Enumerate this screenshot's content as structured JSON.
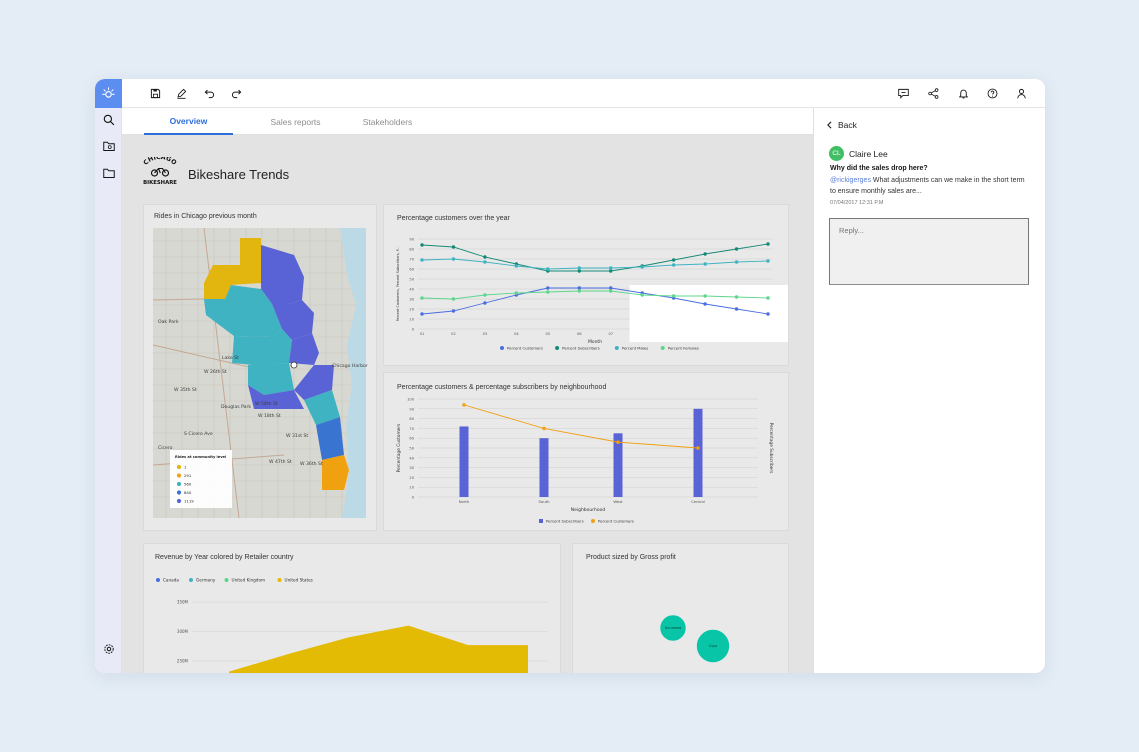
{
  "toolbar": {
    "left_icons": [
      "save-icon",
      "edit-icon",
      "undo-icon",
      "redo-icon"
    ],
    "right_icons": [
      "comment-icon",
      "share-icon",
      "notification-icon",
      "help-icon",
      "user-icon"
    ]
  },
  "rail": {
    "icons": [
      "search-icon",
      "folder-search-icon",
      "folder-icon",
      "settings-icon"
    ]
  },
  "tabs": [
    {
      "label": "Overview",
      "active": true
    },
    {
      "label": "Sales reports",
      "active": false
    },
    {
      "label": "Stakeholders",
      "active": false
    }
  ],
  "dashboard": {
    "logo_text_top": "CHICAGO",
    "logo_text_bottom": "BIKESHARE",
    "title": "Bikeshare Trends"
  },
  "map_card": {
    "title": "Rides in Chicago previous month",
    "legend_title": "Rides at community level",
    "legend_items": [
      {
        "label": "1",
        "color": "#e3b50f"
      },
      {
        "label": "291",
        "color": "#f0a10f"
      },
      {
        "label": "560",
        "color": "#3fb3c1"
      },
      {
        "label": "840",
        "color": "#3a74d1"
      },
      {
        "label": "1119",
        "color": "#5a63d6"
      }
    ],
    "place_labels": [
      "Chicago Harbor",
      "Cicero",
      "Oak Park",
      "W 18th St",
      "W 31st St",
      "W 26th St",
      "W 35th St",
      "Lake St",
      "Douglas Park",
      "W 58th St",
      "W 36th St",
      "W 47th St",
      "S Cicero Ave"
    ]
  },
  "chart_data": [
    {
      "type": "line",
      "title": "Percentage customers over the year",
      "xlabel": "Month",
      "ylabel": "Percent Customers, Percent Subscribers, P...",
      "categories": [
        "01",
        "02",
        "03",
        "04",
        "05",
        "06",
        "07",
        "08",
        "09",
        "10",
        "11",
        "12"
      ],
      "ylim": [
        0,
        90
      ],
      "yticks": [
        0,
        10,
        20,
        30,
        40,
        50,
        60,
        70,
        80,
        90
      ],
      "series": [
        {
          "name": "Percent Customers",
          "color": "#4a6ee0",
          "values": [
            15,
            18,
            26,
            34,
            41,
            41,
            41,
            36,
            31,
            25,
            20,
            15
          ]
        },
        {
          "name": "Percent Subscribers",
          "color": "#138a75",
          "values": [
            84,
            82,
            72,
            65,
            58,
            58,
            58,
            63,
            69,
            75,
            80,
            85
          ]
        },
        {
          "name": "Percent Males",
          "color": "#3fb3c1",
          "values": [
            69,
            70,
            67,
            63,
            60,
            61,
            61,
            62,
            64,
            65,
            67,
            68
          ]
        },
        {
          "name": "Percent Females",
          "color": "#5cd68a",
          "values": [
            31,
            30,
            34,
            36,
            37,
            38,
            38,
            34,
            33,
            33,
            32,
            31
          ]
        }
      ],
      "grid": true,
      "legend": "bottom"
    },
    {
      "type": "bar",
      "title": "Percentage customers & percentage subscribers by neighbourhood",
      "xlabel": "Neighbourhood",
      "ylabel": "Percentage Customers",
      "y2label": "Percentage Subscribers",
      "categories": [
        "North",
        "South",
        "West",
        "Central"
      ],
      "ylim": [
        0,
        100
      ],
      "yticks": [
        0,
        10,
        20,
        30,
        40,
        50,
        60,
        70,
        80,
        90,
        100
      ],
      "series": [
        {
          "name": "Percent Subscribers",
          "type": "bar",
          "color": "#5a63d6",
          "values": [
            72,
            60,
            65,
            90
          ]
        },
        {
          "name": "Percent Customers",
          "type": "line",
          "color": "#f0a010",
          "values": [
            94,
            70,
            56,
            50
          ]
        }
      ],
      "grid": true,
      "legend": "bottom"
    },
    {
      "type": "area",
      "title": "Revenue by Year colored by Retailer country",
      "yticks": [
        "350M",
        "300M",
        "250M"
      ],
      "ylim": [
        230,
        360
      ],
      "x": [
        0,
        1,
        2,
        3,
        4,
        5
      ],
      "series": [
        {
          "name": "Canada",
          "color": "#4a6ee0",
          "values": [
            230,
            232,
            234,
            236,
            238,
            240
          ]
        },
        {
          "name": "Germany",
          "color": "#3fb3c1",
          "values": [
            231,
            233,
            235,
            237,
            239,
            241
          ]
        },
        {
          "name": "United Kingdom",
          "color": "#5cd68a",
          "values": [
            232,
            234,
            236,
            238,
            240,
            242
          ]
        },
        {
          "name": "United States",
          "color": "#e3bb05",
          "values": [
            232,
            262,
            290,
            310,
            277,
            277
          ]
        }
      ],
      "legend": "top-left"
    },
    {
      "type": "bubble",
      "title": "Product sized by Gross profit",
      "bubbles": [
        {
          "label": "Unnamed",
          "color": "#08c5a8",
          "size": 1
        },
        {
          "label": "Cups",
          "color": "#08c5a8",
          "size": 1.6
        },
        {
          "label": "",
          "color": "#08c5a8",
          "size": 4
        }
      ]
    }
  ],
  "comment_panel": {
    "back_label": "Back",
    "initials": "CL",
    "name": "Claire Lee",
    "question": "Why did the sales drop here?",
    "mention": "@rickigerges",
    "body": " What adjustments can we make in the short term to ensure monthly sales are...",
    "timestamp": "07/04/2017 12:31 P.M",
    "reply_placeholder": "Reply..."
  },
  "colors": {
    "accent": "#2d6fd9",
    "rail_logo": "#5b8ef0"
  }
}
